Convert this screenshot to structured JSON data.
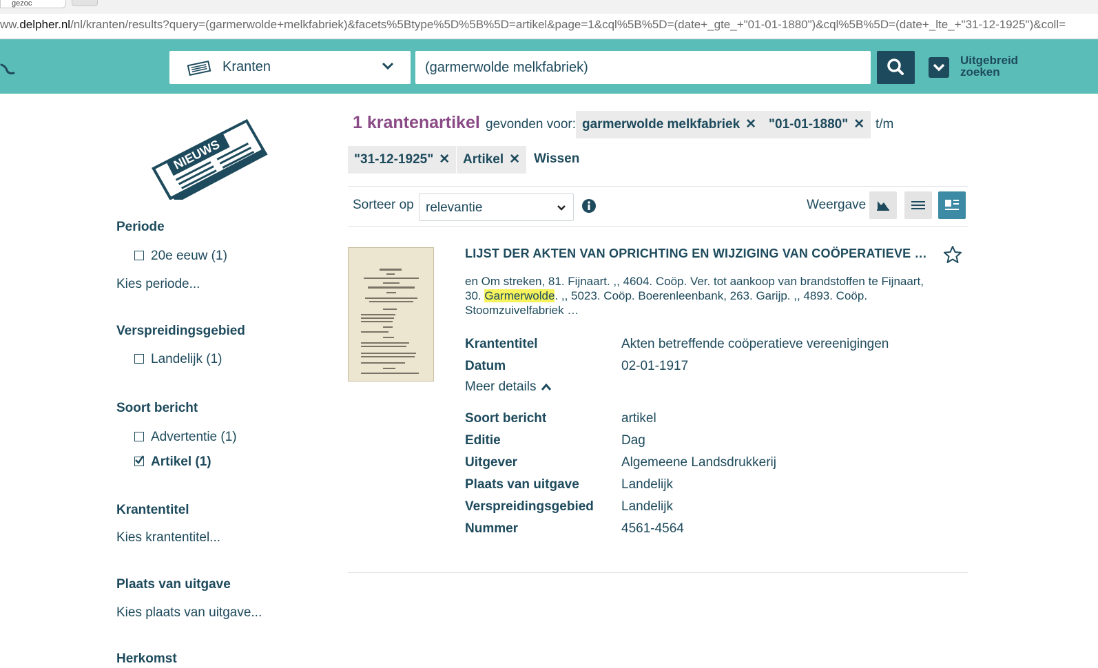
{
  "browser": {
    "tab_title": "gezoc",
    "url_prefix": "ww.",
    "url_domain": "delpher.nl",
    "url_rest": "/nl/kranten/results?query=(garmerwolde+melkfabriek)&facets%5Btype%5D%5B%5D=artikel&page=1&cql%5B%5D=(date+_gte_+\"01-01-1880\")&cql%5B%5D=(date+_lte_+\"31-12-1925\")&coll="
  },
  "header": {
    "collection": "Kranten",
    "search_value": "(garmerwolde melkfabriek)",
    "advanced_label": "Uitgebreid zoeken"
  },
  "sidebar": {
    "logo_text": "NIEUWS",
    "periode": {
      "title": "Periode",
      "option": "20e eeuw (1)",
      "link": "Kies periode..."
    },
    "verspreidingsgebied": {
      "title": "Verspreidingsgebied",
      "option": "Landelijk (1)"
    },
    "soort_bericht": {
      "title": "Soort bericht",
      "options": [
        "Advertentie (1)",
        "Artikel (1)"
      ]
    },
    "krantentitel": {
      "title": "Krantentitel",
      "link": "Kies krantentitel..."
    },
    "plaats": {
      "title": "Plaats van uitgave",
      "link": "Kies plaats van uitgave..."
    },
    "herkomst": {
      "title": "Herkomst"
    }
  },
  "results": {
    "count": "1 krantenartikel",
    "found_for": "gevonden voor:",
    "filters": [
      "garmerwolde melkfabriek",
      "\"01-01-1880\"",
      "\"31-12-1925\"",
      "Artikel"
    ],
    "until": "t/m",
    "clear": "Wissen",
    "sort_label": "Sorteer op",
    "sort_value": "relevantie",
    "view_label": "Weergave"
  },
  "item": {
    "title": "LIJST DER AKTEN VAN OPRICHTING EN WIJZIGING VAN COÖPERATIEVE VEREENIGINGEN",
    "snippet_line1": "en Om streken, 81. Fijnaart. ,, 4604. Coöp. Ver. tot aankoop van brandstoffen te Fijnaart,",
    "snippet_pre": "30. ",
    "snippet_highlight": "Garmerwolde",
    "snippet_post": ". ,, 5023. Coöp. Boerenleenbank, 263. Garijp. ,, 4893. Coöp.",
    "snippet_line3": "Stoomzuivelfabriek …",
    "more_details": "Meer details",
    "details": [
      {
        "key": "Krantentitel",
        "value": "Akten betreffende coöperatieve vereenigingen"
      },
      {
        "key": "Datum",
        "value": "02-01-1917"
      }
    ],
    "extra_details": [
      {
        "key": "Soort bericht",
        "value": "artikel"
      },
      {
        "key": "Editie",
        "value": "Dag"
      },
      {
        "key": "Uitgever",
        "value": "Algemeene Landsdrukkerij"
      },
      {
        "key": "Plaats van uitgave",
        "value": "Landelijk"
      },
      {
        "key": "Verspreidingsgebied",
        "value": "Landelijk"
      },
      {
        "key": "Nummer",
        "value": "4561-4564"
      }
    ]
  },
  "colors": {
    "header": "#5bbdb7",
    "primary": "#1d4a5c",
    "count": "#8a4a86",
    "highlight": "#f6f35c"
  }
}
